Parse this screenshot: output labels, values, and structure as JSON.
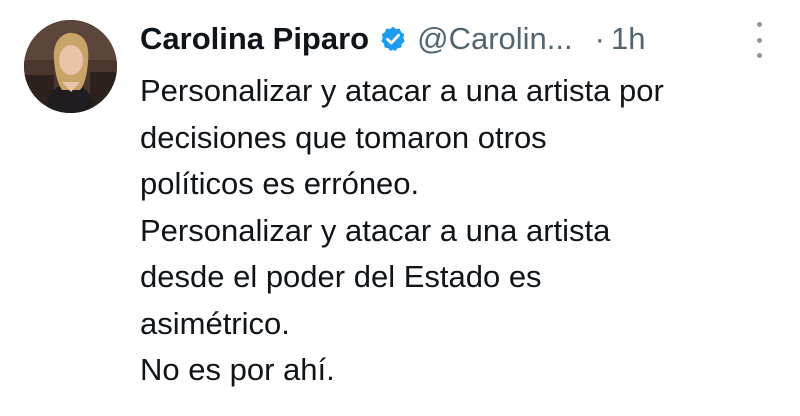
{
  "author": {
    "name": "Carolina Piparo",
    "handle": "@Carolin...",
    "separator": "·",
    "time": "1h",
    "verified_icon": "verified-badge-icon",
    "verified_color": "#1d9bf0"
  },
  "tweet": {
    "lines": [
      "Personalizar y atacar a una artista por",
      "decisiones que tomaron otros",
      "políticos es erróneo.",
      "Personalizar y atacar a una artista",
      "desde el poder del Estado es",
      "asimétrico.",
      "No es por ahí."
    ]
  },
  "colors": {
    "text": "#0f1419",
    "muted": "#536471",
    "background": "#ffffff"
  }
}
